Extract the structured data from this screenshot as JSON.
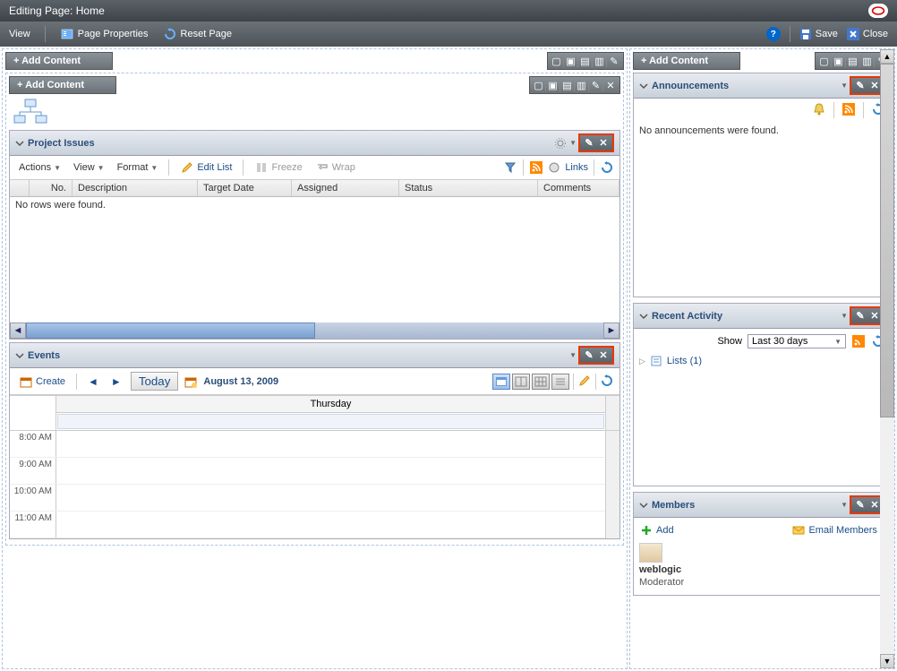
{
  "title": {
    "prefix": "Editing Page:",
    "pageName": "Home"
  },
  "menu": {
    "view": "View",
    "pageProperties": "Page Properties",
    "resetPage": "Reset Page",
    "save": "Save",
    "close": "Close"
  },
  "addContent": "+ Add Content",
  "panels": {
    "projectIssues": {
      "title": "Project Issues",
      "toolbar": {
        "actions": "Actions",
        "view": "View",
        "format": "Format",
        "editList": "Edit List",
        "freeze": "Freeze",
        "wrap": "Wrap",
        "links": "Links"
      },
      "columns": [
        "No.",
        "Description",
        "Target Date",
        "Assigned",
        "Status",
        "Comments"
      ],
      "emptyText": "No rows were found."
    },
    "events": {
      "title": "Events",
      "create": "Create",
      "today": "Today",
      "date": "August 13, 2009",
      "dayHeader": "Thursday",
      "times": [
        "8:00 AM",
        "9:00 AM",
        "10:00 AM",
        "11:00 AM"
      ]
    },
    "announcements": {
      "title": "Announcements",
      "emptyText": "No announcements were found."
    },
    "recentActivity": {
      "title": "Recent Activity",
      "showLabel": "Show",
      "showValue": "Last 30 days",
      "listsLabel": "Lists (1)"
    },
    "members": {
      "title": "Members",
      "add": "Add",
      "emailMembers": "Email Members",
      "member": {
        "name": "weblogic",
        "role": "Moderator"
      }
    }
  }
}
